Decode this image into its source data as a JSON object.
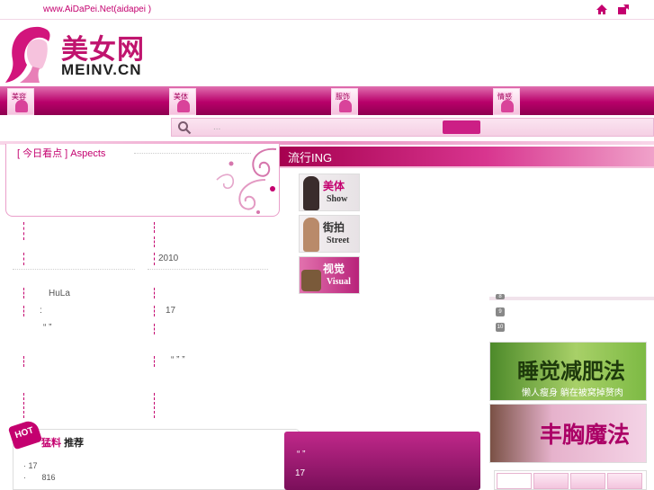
{
  "topbar": {
    "site_link": "www.AiDaPei.Net(aidapei      )",
    "home_icon": "home-icon",
    "bookmark_icon": "bookmark-icon"
  },
  "logo": {
    "cn": "美女网",
    "en": "MEINV.CN"
  },
  "nav": {
    "items": [
      {
        "label": "美容"
      },
      {
        "label": "美体"
      },
      {
        "label": "服饰"
      },
      {
        "label": "情感"
      }
    ]
  },
  "search": {
    "placeholder": "..."
  },
  "aspects": {
    "title": "[ 今日看点 ] Aspects"
  },
  "trend": {
    "header": "流行ING",
    "cards": [
      {
        "cn": "美体",
        "en": "Show"
      },
      {
        "cn": "街拍",
        "en": "Street"
      },
      {
        "cn": "视觉",
        "en": "Visual"
      }
    ]
  },
  "articles": {
    "year": "2010",
    "brand": "HuLa",
    "colon": ":",
    "num17": "17",
    "quote1": "“  ”",
    "quote2": "“  ” ”"
  },
  "sidebar": {
    "ranks": [
      "8",
      "9",
      "10"
    ],
    "banner_sleep_title": "睡觉减肥法",
    "banner_sleep_sub": "懒人瘦身 躺在被窝掉赘肉",
    "banner_breast_title": "丰胸魔法"
  },
  "hot": {
    "badge": "HOT",
    "title_a": "猛料",
    "title_b": "推荐",
    "line1": "17",
    "line2": "816"
  },
  "purple": {
    "line1": "“ ”",
    "line2": "17"
  },
  "colors": {
    "brand": "#c4006f",
    "nav_dark": "#8e0050"
  }
}
